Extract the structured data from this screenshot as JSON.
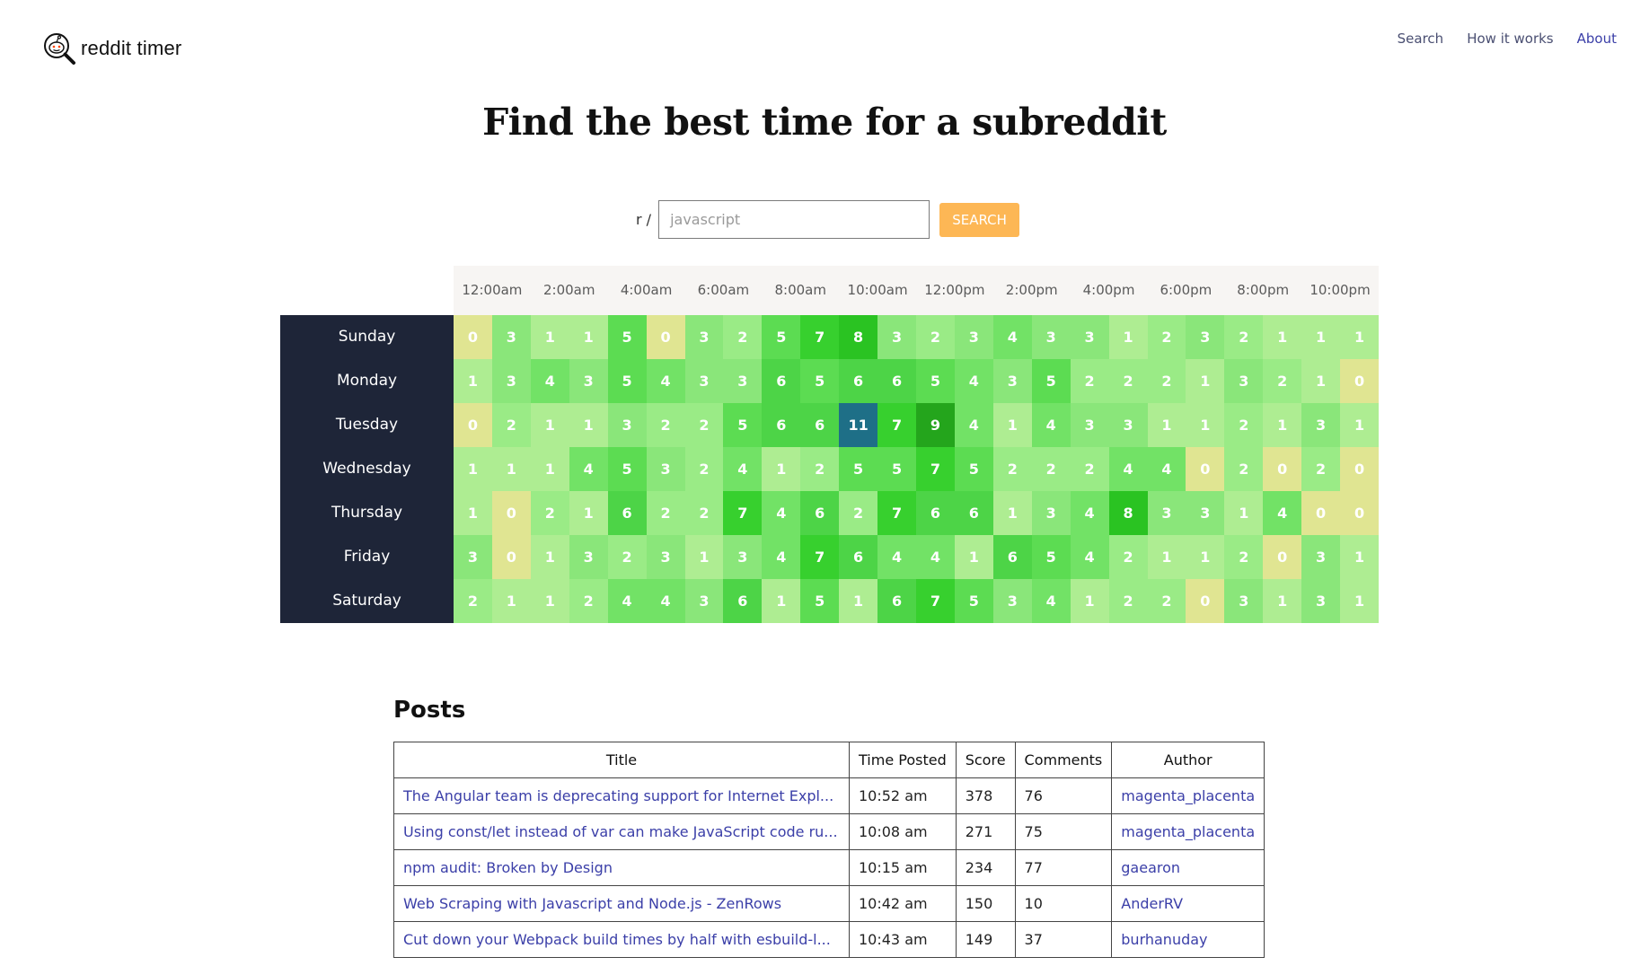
{
  "header": {
    "logo_text": "reddit timer",
    "logo_icon": "magnifier-alien-icon",
    "nav": [
      "Search",
      "How it works",
      "About"
    ]
  },
  "hero": {
    "title": "Find the best time for a subreddit"
  },
  "search": {
    "prefix": "r /",
    "value": "javascript",
    "button_label": "SEARCH",
    "button_color": "#fdb755"
  },
  "heatmap": {
    "hours": [
      "12:00am",
      "2:00am",
      "4:00am",
      "6:00am",
      "8:00am",
      "10:00am",
      "12:00pm",
      "2:00pm",
      "4:00pm",
      "6:00pm",
      "8:00pm",
      "10:00pm"
    ],
    "days": [
      "Sunday",
      "Monday",
      "Tuesday",
      "Wednesday",
      "Thursday",
      "Friday",
      "Saturday"
    ],
    "values": [
      [
        0,
        3,
        1,
        1,
        5,
        0,
        3,
        2,
        5,
        7,
        8,
        3,
        2,
        3,
        4,
        3,
        3,
        1,
        2,
        3,
        2,
        1,
        1,
        1
      ],
      [
        1,
        3,
        4,
        3,
        5,
        4,
        3,
        3,
        6,
        5,
        6,
        6,
        5,
        4,
        3,
        5,
        2,
        2,
        2,
        1,
        3,
        2,
        1,
        0
      ],
      [
        0,
        2,
        1,
        1,
        3,
        2,
        2,
        5,
        6,
        6,
        11,
        7,
        9,
        4,
        1,
        4,
        3,
        3,
        1,
        1,
        2,
        1,
        3,
        1
      ],
      [
        1,
        1,
        1,
        4,
        5,
        3,
        2,
        4,
        1,
        2,
        5,
        5,
        7,
        5,
        2,
        2,
        2,
        4,
        4,
        0,
        2,
        0,
        2,
        0
      ],
      [
        1,
        0,
        2,
        1,
        6,
        2,
        2,
        7,
        4,
        6,
        2,
        7,
        6,
        6,
        1,
        3,
        4,
        8,
        3,
        3,
        1,
        4,
        0,
        0
      ],
      [
        3,
        0,
        1,
        3,
        2,
        3,
        1,
        3,
        4,
        7,
        6,
        4,
        4,
        1,
        6,
        5,
        4,
        2,
        1,
        1,
        2,
        0,
        3,
        1
      ],
      [
        2,
        1,
        1,
        2,
        4,
        4,
        3,
        6,
        1,
        5,
        1,
        6,
        7,
        5,
        3,
        4,
        1,
        2,
        2,
        0,
        3,
        1,
        3,
        1
      ]
    ],
    "colors": {
      "zero": "#e0e592",
      "low": "#aeed92",
      "max": "#1e6f87",
      "day_bg": "#1e2538",
      "hours_bg": "#f7f5f3"
    }
  },
  "posts": {
    "title": "Posts",
    "columns": [
      "Title",
      "Time Posted",
      "Score",
      "Comments",
      "Author"
    ],
    "rows": [
      [
        "The Angular team is deprecating support for Internet Expl...",
        "10:52 am",
        "378",
        "76",
        "magenta_placenta"
      ],
      [
        "Using const/let instead of var can make JavaScript code ru...",
        "10:08 am",
        "271",
        "75",
        "magenta_placenta"
      ],
      [
        "npm audit: Broken by Design",
        "10:15 am",
        "234",
        "77",
        "gaearon"
      ],
      [
        "Web Scraping with Javascript and Node.js - ZenRows",
        "10:42 am",
        "150",
        "10",
        "AnderRV"
      ],
      [
        "Cut down your Webpack build times by half with esbuild-l...",
        "10:43 am",
        "149",
        "37",
        "burhanuday"
      ]
    ]
  }
}
